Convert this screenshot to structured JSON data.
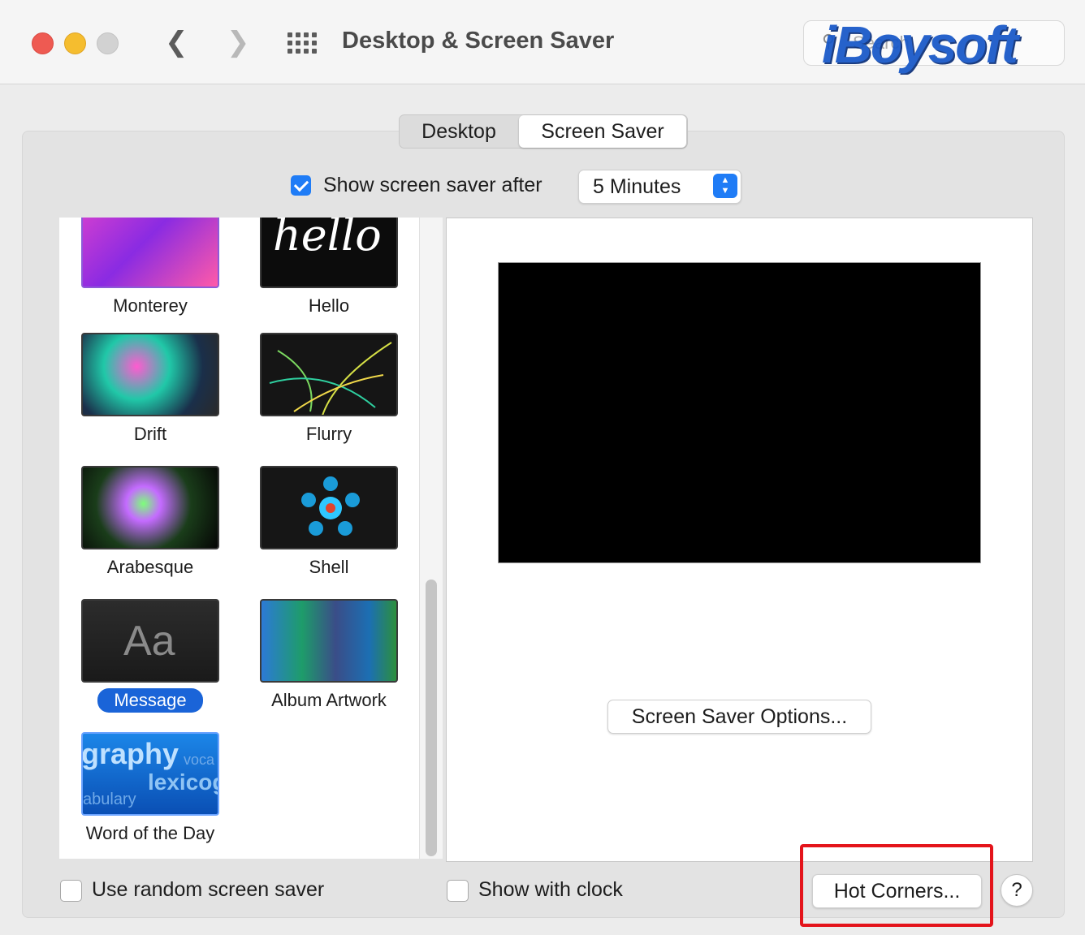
{
  "window": {
    "title": "Desktop & Screen Saver",
    "search_placeholder": "Search",
    "watermark": "iBoysoft"
  },
  "tabs": [
    {
      "label": "Desktop",
      "selected": false
    },
    {
      "label": "Screen Saver",
      "selected": true
    }
  ],
  "show_after": {
    "label": "Show screen saver after",
    "checked": true,
    "value": "5 Minutes"
  },
  "savers": [
    {
      "name": "Monterey",
      "selected": false
    },
    {
      "name": "Hello",
      "selected": false,
      "thumb_text": "hello"
    },
    {
      "name": "Drift",
      "selected": false
    },
    {
      "name": "Flurry",
      "selected": false
    },
    {
      "name": "Arabesque",
      "selected": false
    },
    {
      "name": "Shell",
      "selected": false
    },
    {
      "name": "Message",
      "selected": true,
      "thumb_text": "Aa"
    },
    {
      "name": "Album Artwork",
      "selected": false
    },
    {
      "name": "Word of the Day",
      "selected": false
    }
  ],
  "word_thumb": {
    "w1": "graphy",
    "w2": "lexicog",
    "w3": "abulary",
    "w4": "voca"
  },
  "buttons": {
    "options": "Screen Saver Options...",
    "hot_corners": "Hot Corners...",
    "help": "?"
  },
  "bottom": {
    "random_label": "Use random screen saver",
    "random_checked": false,
    "clock_label": "Show with clock",
    "clock_checked": false
  },
  "colors": {
    "accent": "#1f7cf6",
    "selection": "#1a64d8",
    "highlight_box": "#e4141b"
  }
}
